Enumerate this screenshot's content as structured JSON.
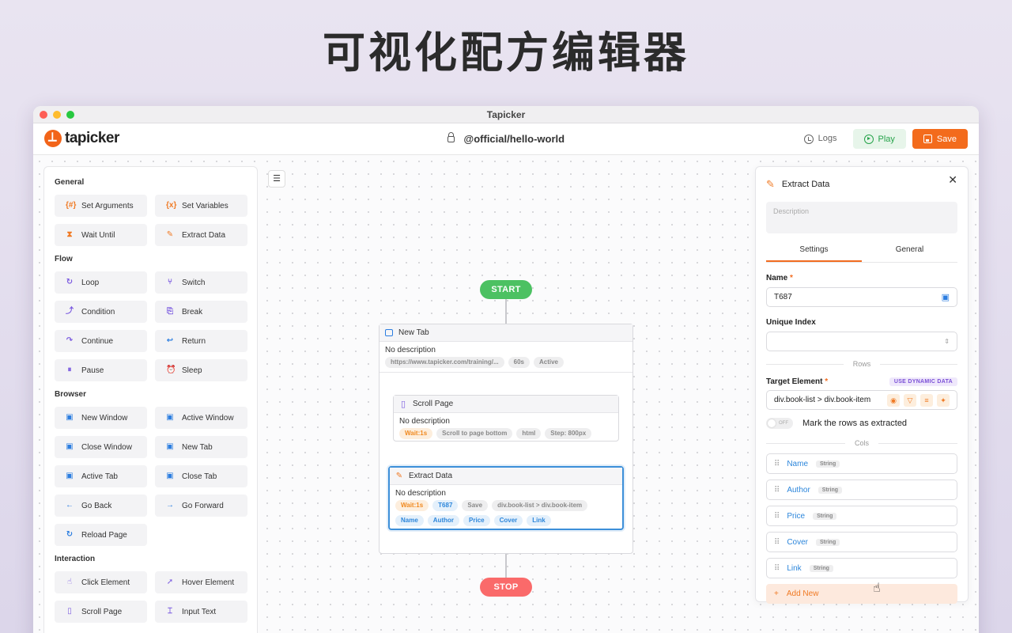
{
  "headline": "可视化配方编辑器",
  "window": {
    "title": "Tapicker"
  },
  "appbar": {
    "brand": "tapicker",
    "recipe_path": "@official/hello-world",
    "logs_label": "Logs",
    "play_label": "Play",
    "save_label": "Save"
  },
  "palette": {
    "sections": [
      {
        "title": "General",
        "items": [
          {
            "label": "Set Arguments",
            "icon": "{#}"
          },
          {
            "label": "Set Variables",
            "icon": "{x}"
          },
          {
            "label": "Wait Until",
            "icon": "⧗"
          },
          {
            "label": "Extract Data",
            "icon": "✎"
          }
        ]
      },
      {
        "title": "Flow",
        "items": [
          {
            "label": "Loop",
            "icon": "↻"
          },
          {
            "label": "Switch",
            "icon": "⑂"
          },
          {
            "label": "Condition",
            "icon": "⤴"
          },
          {
            "label": "Break",
            "icon": "⎘"
          },
          {
            "label": "Continue",
            "icon": "↷"
          },
          {
            "label": "Return",
            "icon": "↩"
          },
          {
            "label": "Pause",
            "icon": "⏸"
          },
          {
            "label": "Sleep",
            "icon": "⏰"
          }
        ]
      },
      {
        "title": "Browser",
        "items": [
          {
            "label": "New Window",
            "icon": "▣"
          },
          {
            "label": "Active Window",
            "icon": "▣"
          },
          {
            "label": "Close Window",
            "icon": "▣"
          },
          {
            "label": "New Tab",
            "icon": "▣"
          },
          {
            "label": "Active Tab",
            "icon": "▣"
          },
          {
            "label": "Close Tab",
            "icon": "▣"
          },
          {
            "label": "Go Back",
            "icon": "←"
          },
          {
            "label": "Go Forward",
            "icon": "→"
          },
          {
            "label": "Reload Page",
            "icon": "↻"
          }
        ]
      },
      {
        "title": "Interaction",
        "items": [
          {
            "label": "Click Element",
            "icon": "☝"
          },
          {
            "label": "Hover Element",
            "icon": "➚"
          },
          {
            "label": "Scroll Page",
            "icon": "▯"
          },
          {
            "label": "Input Text",
            "icon": "⌶"
          }
        ]
      }
    ]
  },
  "flow": {
    "start_label": "START",
    "stop_label": "STOP",
    "new_tab": {
      "title": "New Tab",
      "description": "No description",
      "tags": [
        "https://www.tapicker.com/training/...",
        "60s",
        "Active"
      ]
    },
    "scroll_page": {
      "title": "Scroll Page",
      "description": "No description",
      "tags": [
        "Wait:1s",
        "Scroll to page bottom",
        "html",
        "Step: 800px"
      ]
    },
    "extract_data": {
      "title": "Extract Data",
      "description": "No description",
      "tags": [
        "Wait:1s",
        "T687",
        "Save",
        "div.book-list > div.book-item"
      ],
      "cols": [
        "Name",
        "Author",
        "Price",
        "Cover",
        "Link"
      ]
    }
  },
  "panel": {
    "title": "Extract Data",
    "description_placeholder": "Description",
    "tabs": [
      "Settings",
      "General"
    ],
    "name_label": "Name",
    "name_value": "T687",
    "unique_index_label": "Unique Index",
    "rows_divider": "Rows",
    "target_element_label": "Target Element",
    "dynamic_data_label": "USE DYNAMIC DATA",
    "target_element_value": "div.book-list > div.book-item",
    "toggle_state": "OFF",
    "mark_rows_label": "Mark the rows as extracted",
    "cols_divider": "Cols",
    "cols": [
      {
        "name": "Name",
        "type": "String"
      },
      {
        "name": "Author",
        "type": "String"
      },
      {
        "name": "Price",
        "type": "String"
      },
      {
        "name": "Cover",
        "type": "String"
      },
      {
        "name": "Link",
        "type": "String"
      }
    ],
    "add_new_label": "Add New"
  },
  "colors": {
    "accent": "#f26c20",
    "start": "#4cc162",
    "stop": "#fa6a6a",
    "selected": "#3c8fd9"
  }
}
